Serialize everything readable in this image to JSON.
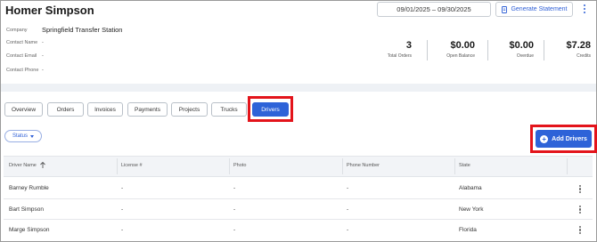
{
  "header": {
    "title": "Homer Simpson",
    "date_range": "09/01/2025 – 09/30/2025",
    "generate_statement": "Generate Statement"
  },
  "info": {
    "company_label": "Company",
    "company_value": "Springfield Transfer Station",
    "contact_name_label": "Contact Name",
    "contact_name_value": "-",
    "contact_email_label": "Contact Email",
    "contact_email_value": "-",
    "contact_phone_label": "Contact Phone",
    "contact_phone_value": "-"
  },
  "stats": [
    {
      "value": "3",
      "label": "Total Orders"
    },
    {
      "value": "$0.00",
      "label": "Open Balance"
    },
    {
      "value": "$0.00",
      "label": "Overdue"
    },
    {
      "value": "$7.28",
      "label": "Credits"
    }
  ],
  "tabs": [
    "Overview",
    "Orders",
    "Invoices",
    "Payments",
    "Projects",
    "Trucks",
    "Drivers"
  ],
  "active_tab": "Drivers",
  "filters": {
    "status_label": "Status"
  },
  "actions": {
    "add_drivers": "Add Drivers"
  },
  "table": {
    "columns": [
      "Driver Name",
      "License #",
      "Photo",
      "Phone Number",
      "State"
    ],
    "rows": [
      {
        "name": "Barney Rumble",
        "license": "-",
        "photo": "-",
        "phone": "-",
        "state": "Alabama"
      },
      {
        "name": "Bart Simpson",
        "license": "-",
        "photo": "-",
        "phone": "-",
        "state": "New York"
      },
      {
        "name": "Marge Simpson",
        "license": "-",
        "photo": "-",
        "phone": "-",
        "state": "Florida"
      }
    ]
  },
  "colors": {
    "accent": "#2e63d8",
    "highlight": "#e3141b"
  },
  "icons": {
    "statement": "document-icon",
    "menu": "kebab-menu-icon",
    "sort": "arrow-up-icon",
    "add": "plus-circle-icon"
  }
}
